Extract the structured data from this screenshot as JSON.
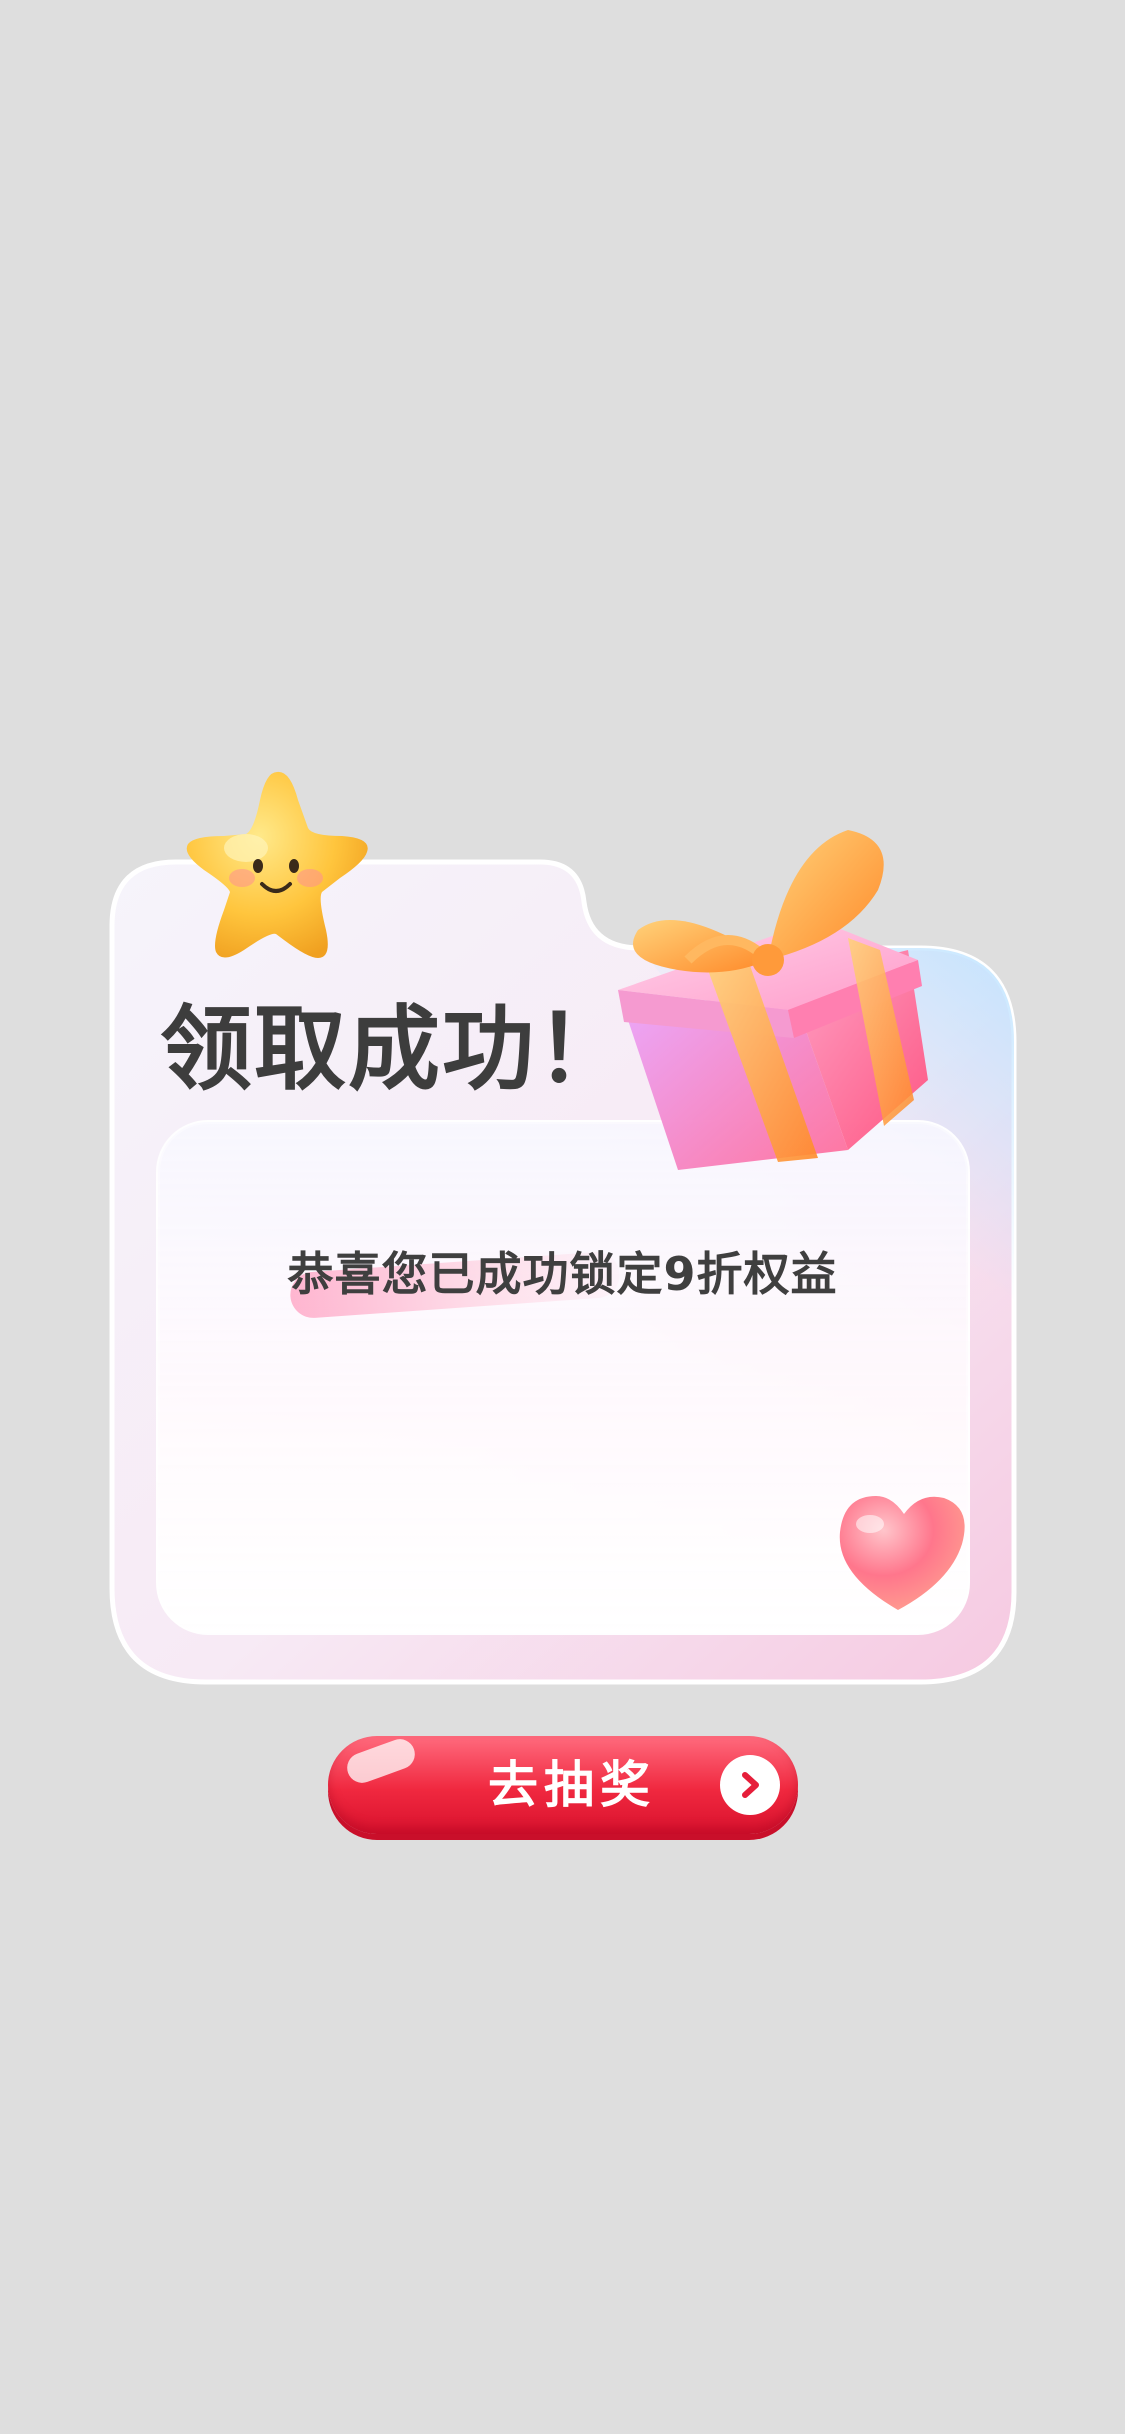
{
  "dialog": {
    "title": "领取成功！",
    "message": "恭喜您已成功锁定9折权益",
    "action_label": "去抽奖"
  },
  "icons": {
    "star": "smiling-star-icon",
    "gift": "gift-box-icon",
    "heart": "heart-icon",
    "arrow": "chevron-right-icon"
  },
  "colors": {
    "background": "#dedede",
    "title_text": "#3d3d3d",
    "button_red": "#f0283f",
    "accent_pink": "#ff9fbf",
    "accent_blue": "#bfe3ff",
    "star_yellow": "#ffc53d"
  }
}
